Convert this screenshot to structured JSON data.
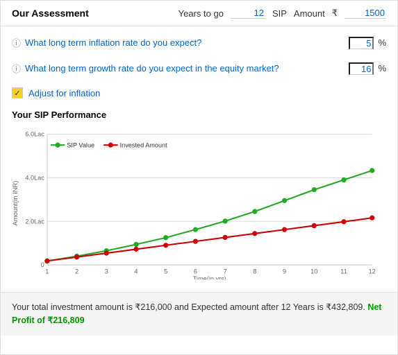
{
  "header": {
    "title": "Our Assessment",
    "years_label": "Years to go",
    "years_value": "12",
    "sip_label": "SIP",
    "amount_label": "Amount",
    "rupee_symbol": "₹",
    "amount_value": "1500"
  },
  "questions": [
    {
      "id": "q1",
      "text": "What long term inflation rate do you expect?",
      "value": "5",
      "unit": "%"
    },
    {
      "id": "q2",
      "text": "What long term growth rate do you expect in the equity market?",
      "value": "16",
      "unit": "%"
    }
  ],
  "adjust": {
    "label": "Adjust for inflation",
    "checked": true,
    "check_mark": "✓"
  },
  "chart": {
    "title": "Your SIP Performance",
    "y_label": "Amount(in INR)",
    "x_label": "Time(in yrs)",
    "y_ticks": [
      "0",
      "2.0Lac",
      "4.0Lac",
      "6.0Lac"
    ],
    "x_ticks": [
      "1",
      "2",
      "3",
      "4",
      "5",
      "6",
      "7",
      "8",
      "9",
      "10",
      "11",
      "12"
    ],
    "legend": [
      {
        "label": "SIP Value",
        "color": "#22aa22"
      },
      {
        "label": "Invested Amount",
        "color": "#cc0000"
      }
    ],
    "sip_value_points": [
      [
        1,
        0.18
      ],
      [
        2,
        0.4
      ],
      [
        3,
        0.65
      ],
      [
        4,
        0.94
      ],
      [
        5,
        1.25
      ],
      [
        6,
        1.62
      ],
      [
        7,
        2.01
      ],
      [
        8,
        2.45
      ],
      [
        9,
        2.95
      ],
      [
        10,
        3.45
      ],
      [
        11,
        3.9
      ],
      [
        12,
        4.33
      ]
    ],
    "invested_points": [
      [
        1,
        0.18
      ],
      [
        2,
        0.36
      ],
      [
        3,
        0.54
      ],
      [
        4,
        0.72
      ],
      [
        5,
        0.9
      ],
      [
        6,
        1.08
      ],
      [
        7,
        1.26
      ],
      [
        8,
        1.44
      ],
      [
        9,
        1.62
      ],
      [
        10,
        1.8
      ],
      [
        11,
        1.98
      ],
      [
        12,
        2.16
      ]
    ],
    "y_max": 6.0
  },
  "footer": {
    "text1": "Your total investment amount is ₹216,000 and Expected amount after 12 Years is ₹432,809.",
    "net_profit_label": "Net Profit of ₹216,809",
    "full_text": "Your total investment amount is ₹216,000 and Expected amount after 12 Years is ₹432,809."
  }
}
